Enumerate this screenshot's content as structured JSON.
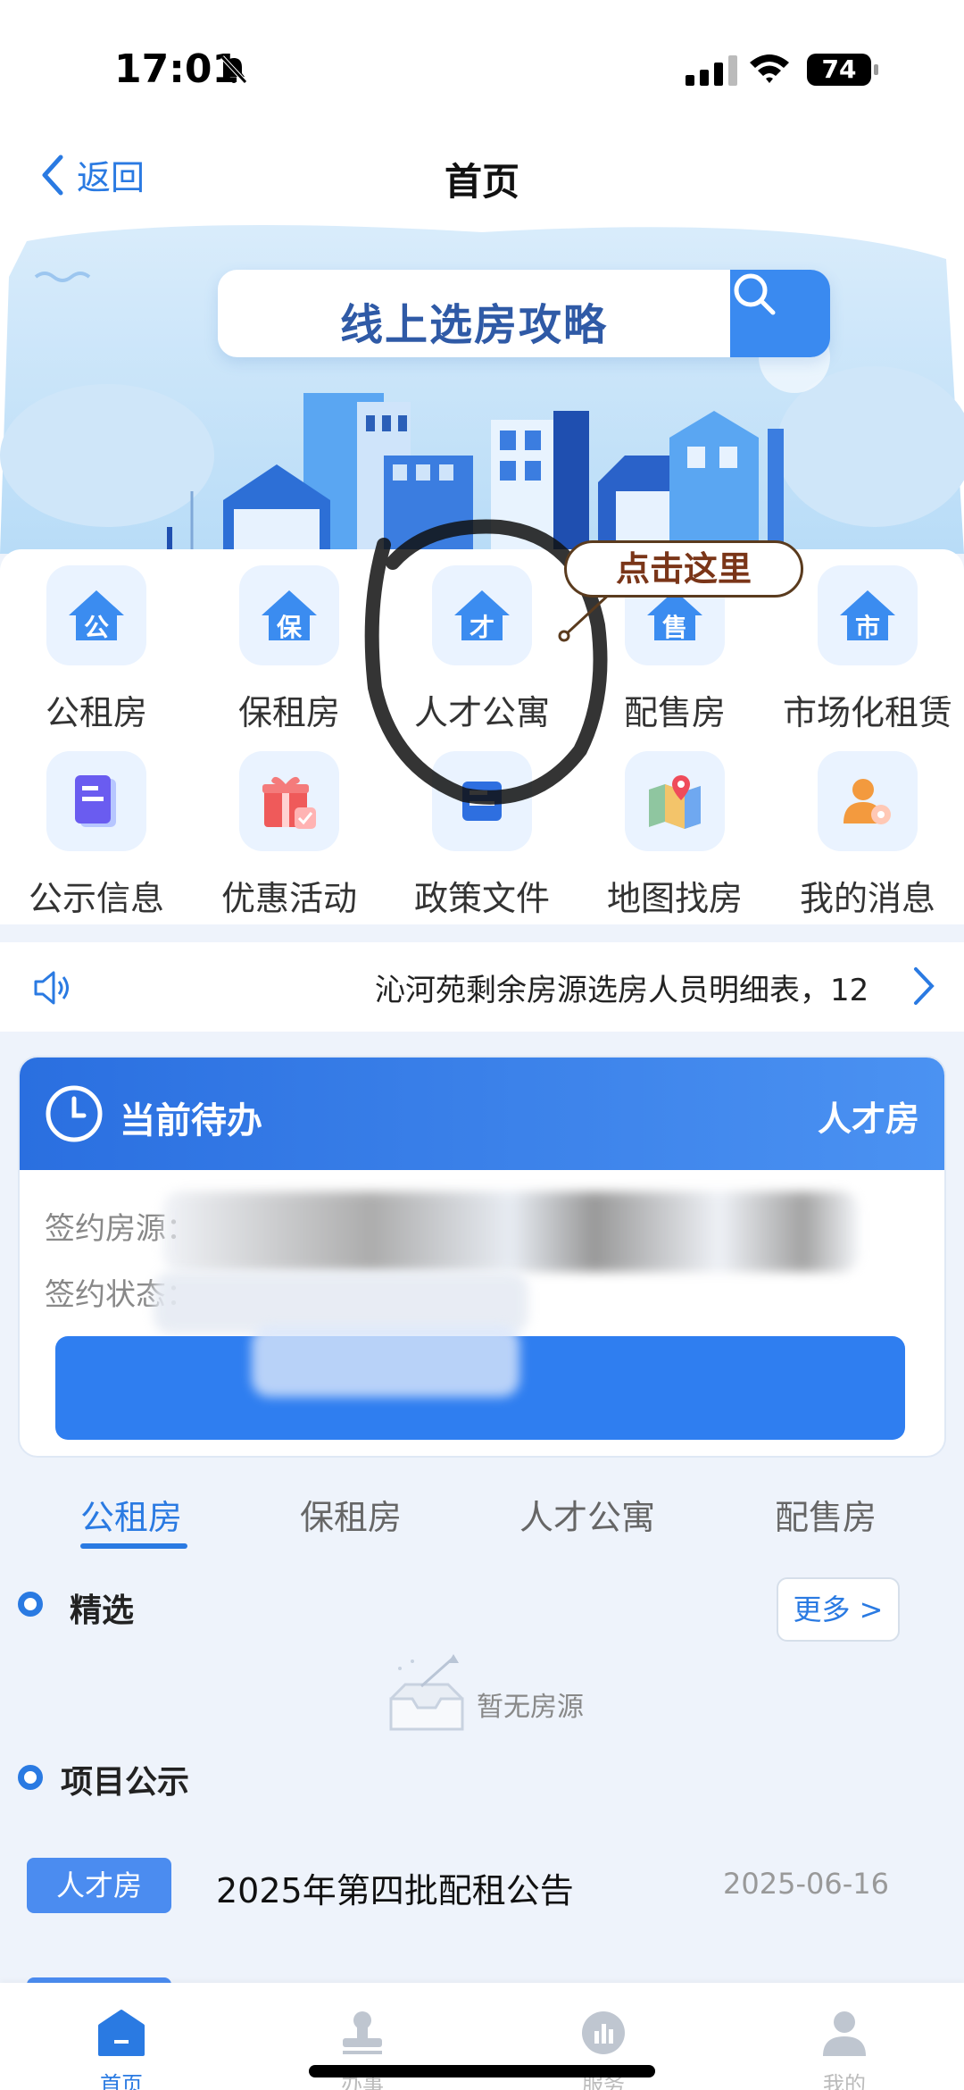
{
  "status_bar": {
    "time": "17:01",
    "battery": "74"
  },
  "nav": {
    "back_label": "返回",
    "title": "首页"
  },
  "banner": {
    "search_label": "线上选房攻略"
  },
  "categories": [
    {
      "label": "公租房",
      "glyph": "公",
      "icon": "public-housing-icon"
    },
    {
      "label": "保租房",
      "glyph": "保",
      "icon": "guaranteed-rental-icon"
    },
    {
      "label": "人才公寓",
      "glyph": "才",
      "icon": "talent-apartment-icon"
    },
    {
      "label": "配售房",
      "glyph": "售",
      "icon": "allotted-sale-icon"
    },
    {
      "label": "市场化租赁",
      "glyph": "市",
      "icon": "market-rental-icon"
    },
    {
      "label": "公示信息",
      "icon": "document-icon"
    },
    {
      "label": "优惠活动",
      "icon": "gift-icon"
    },
    {
      "label": "政策文件",
      "icon": "policy-file-icon"
    },
    {
      "label": "地图找房",
      "icon": "map-icon"
    },
    {
      "label": "我的消息",
      "icon": "user-message-icon"
    }
  ],
  "annotation": {
    "text": "点击这里"
  },
  "notice": {
    "text": "沁河苑剩余房源选房人员明细表，12"
  },
  "todo": {
    "title": "当前待办",
    "kind": "人才房",
    "row1_label": "签约房源：",
    "row2_label": "签约状态："
  },
  "tabs": [
    "公租房",
    "保租房",
    "人才公寓",
    "配售房"
  ],
  "featured": {
    "title": "精选",
    "more": "更多 >",
    "empty": "暂无房源"
  },
  "projects": {
    "title": "项目公示",
    "items": [
      {
        "tag": "人才房",
        "name": "2025年第四批配租公告",
        "date": "2025-06-16"
      }
    ]
  },
  "bottom_nav": [
    "首页",
    "办事",
    "服务",
    "我的"
  ],
  "colors": {
    "accent": "#2a7ae2",
    "annotation": "#7a3518"
  }
}
